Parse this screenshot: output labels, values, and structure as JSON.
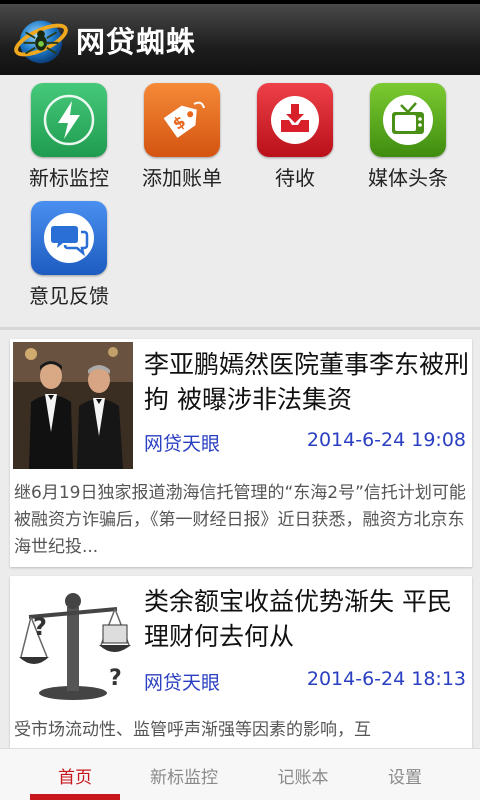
{
  "app": {
    "title": "网贷蜘蛛"
  },
  "grid": {
    "items": [
      {
        "label": "新标监控",
        "icon": "lightning-icon",
        "color": "#2fb463"
      },
      {
        "label": "添加账单",
        "icon": "price-tag-icon",
        "color": "#e9671c"
      },
      {
        "label": "待收",
        "icon": "download-inbox-icon",
        "color": "#d8202b"
      },
      {
        "label": "媒体头条",
        "icon": "tv-icon",
        "color": "#5aa81c"
      },
      {
        "label": "意见反馈",
        "icon": "chat-bubbles-icon",
        "color": "#2a6fd6"
      }
    ]
  },
  "news": [
    {
      "title": "李亚鹏嫣然医院董事李东被刑拘 被曝涉非法集资",
      "source": "网贷天眼",
      "time": "2014-6-24 19:08",
      "summary": "继6月19日独家报道渤海信托管理的“东海2号”信托计划可能被融资方诈骗后，《第一财经日报》近日获悉，融资方北京东海世纪投...",
      "thumb": "two-men-in-suits-photo"
    },
    {
      "title": "类余额宝收益优势渐失 平民理财何去何从",
      "source": "网贷天眼",
      "time": "2014-6-24 18:13",
      "summary": "受市场流动性、监管呼声渐强等因素的影响，互",
      "thumb": "balance-scale-illustration"
    }
  ],
  "bottom_nav": {
    "tabs": [
      {
        "label": "首页",
        "active": true
      },
      {
        "label": "新标监控",
        "active": false
      },
      {
        "label": "记账本",
        "active": false
      },
      {
        "label": "设置",
        "active": false
      }
    ],
    "active_color": "#c8161d"
  }
}
